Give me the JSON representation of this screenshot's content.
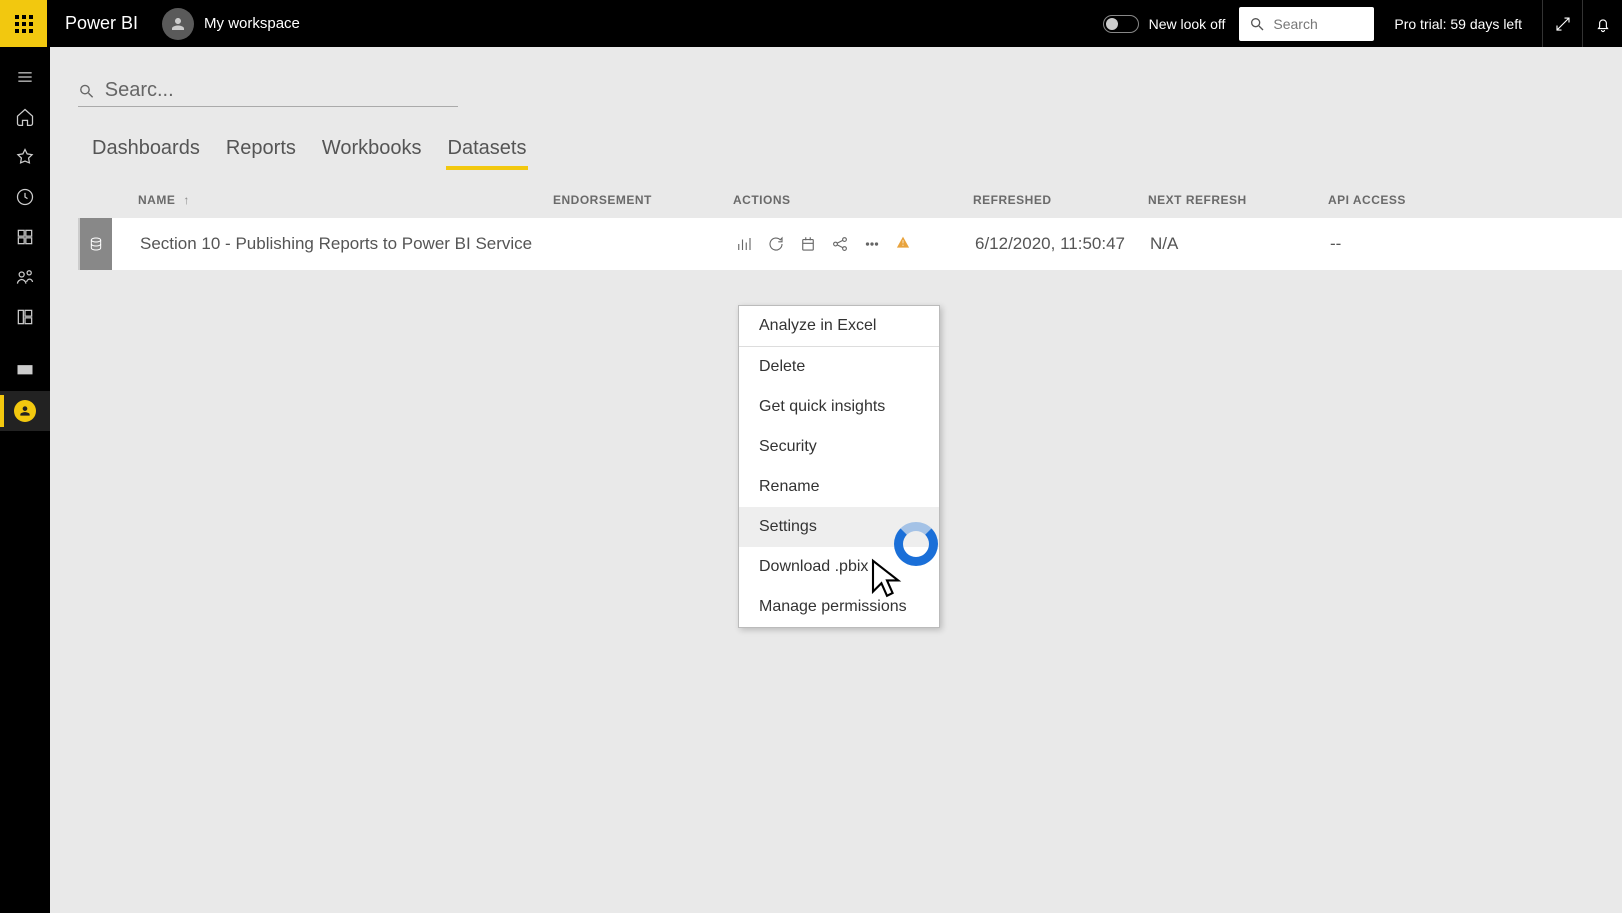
{
  "topbar": {
    "brand": "Power BI",
    "workspace": "My workspace",
    "new_look_label": "New look off",
    "search_placeholder": "Search",
    "trial_text": "Pro trial: 59 days left"
  },
  "leftnav": {
    "items": [
      {
        "name": "hamburger-icon"
      },
      {
        "name": "home-icon"
      },
      {
        "name": "favorites-icon"
      },
      {
        "name": "recent-icon"
      },
      {
        "name": "apps-icon"
      },
      {
        "name": "shared-icon"
      },
      {
        "name": "workspaces-icon"
      },
      {
        "name": "monitor-icon"
      },
      {
        "name": "my-workspace-icon"
      }
    ]
  },
  "filter": {
    "placeholder": "Searc..."
  },
  "tabs": {
    "items": [
      {
        "label": "Dashboards",
        "active": false
      },
      {
        "label": "Reports",
        "active": false
      },
      {
        "label": "Workbooks",
        "active": false
      },
      {
        "label": "Datasets",
        "active": true
      }
    ]
  },
  "columns": {
    "name": "NAME",
    "endorsement": "ENDORSEMENT",
    "actions": "ACTIONS",
    "refreshed": "REFRESHED",
    "next_refresh": "NEXT REFRESH",
    "api_access": "API ACCESS",
    "sort_arrow": "↑"
  },
  "rows": [
    {
      "name": "Section 10 - Publishing Reports to Power BI Service",
      "refreshed": "6/12/2020, 11:50:47",
      "next_refresh": "N/A",
      "api_access": "--"
    }
  ],
  "context_menu": {
    "items": [
      {
        "label": "Analyze in Excel",
        "separator": true
      },
      {
        "label": "Delete"
      },
      {
        "label": "Get quick insights"
      },
      {
        "label": "Security"
      },
      {
        "label": "Rename"
      },
      {
        "label": "Settings",
        "hover": true
      },
      {
        "label": "Download .pbix"
      },
      {
        "label": "Manage permissions"
      }
    ]
  }
}
